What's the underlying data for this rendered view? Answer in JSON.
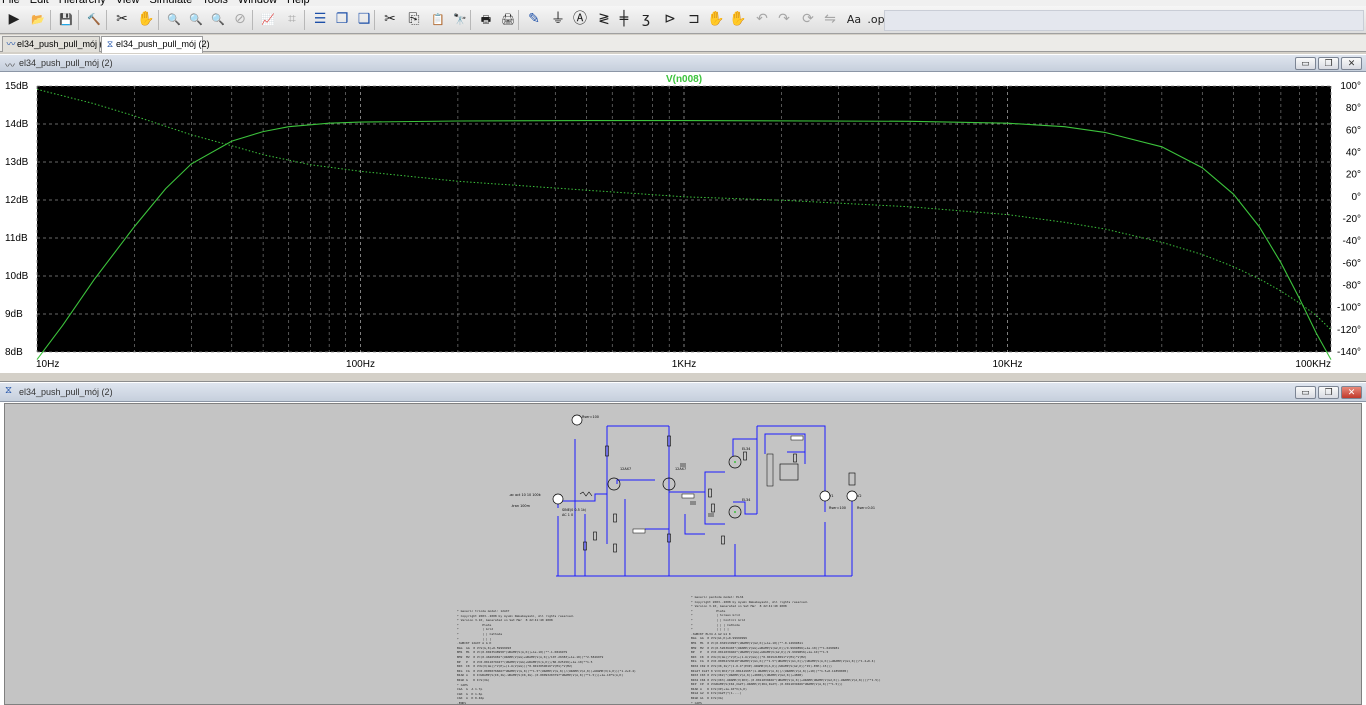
{
  "menubar": {
    "items": [
      "File",
      "Edit",
      "Hierarchy",
      "View",
      "Simulate",
      "Tools",
      "Window",
      "Help"
    ]
  },
  "toolbar": {
    "buttons": [
      {
        "icon": "run-icon",
        "glyph": "▶"
      },
      {
        "icon": "open-icon",
        "glyph": "📂"
      },
      {
        "icon": "save-icon",
        "glyph": "💾"
      },
      {
        "icon": "control-panel-icon",
        "glyph": "🔨"
      },
      {
        "icon": "halt-icon",
        "glyph": "✂"
      },
      {
        "icon": "pan-icon",
        "glyph": "✋"
      },
      {
        "icon": "zoom-in-icon",
        "glyph": "🔍"
      },
      {
        "icon": "zoom-back-icon",
        "glyph": "🔍"
      },
      {
        "icon": "zoom-out-icon",
        "glyph": "🔍"
      },
      {
        "icon": "zoom-fit-icon",
        "glyph": "⊘"
      },
      {
        "icon": "autorange-icon",
        "glyph": "📈"
      },
      {
        "icon": "grid-icon",
        "glyph": "⌗"
      },
      {
        "icon": "tile-horizontal-icon",
        "glyph": "☰"
      },
      {
        "icon": "cascade-icon",
        "glyph": "❐"
      },
      {
        "icon": "tile-vertical-icon",
        "glyph": "❑"
      },
      {
        "icon": "cut-icon",
        "glyph": "✂"
      },
      {
        "icon": "copy-icon",
        "glyph": "⎘"
      },
      {
        "icon": "paste-icon",
        "glyph": "📋"
      },
      {
        "icon": "find-icon",
        "glyph": "🔭"
      },
      {
        "icon": "print-icon",
        "glyph": "🖶"
      },
      {
        "icon": "print-setup-icon",
        "glyph": "🖨"
      },
      {
        "icon": "draw-wire-icon",
        "glyph": "✎"
      },
      {
        "icon": "ground-icon",
        "glyph": "⏚"
      },
      {
        "icon": "label-net-icon",
        "glyph": "Ⓐ"
      },
      {
        "icon": "resistor-icon",
        "glyph": "≷"
      },
      {
        "icon": "capacitor-icon",
        "glyph": "╪"
      },
      {
        "icon": "inductor-icon",
        "glyph": "ʒ"
      },
      {
        "icon": "diode-icon",
        "glyph": "⊳"
      },
      {
        "icon": "component-icon",
        "glyph": "⊐"
      },
      {
        "icon": "move-icon",
        "glyph": "✋"
      },
      {
        "icon": "drag-icon",
        "glyph": "✋"
      },
      {
        "icon": "undo-icon",
        "glyph": "↶"
      },
      {
        "icon": "redo-icon",
        "glyph": "↷"
      },
      {
        "icon": "rotate-icon",
        "glyph": "⟳"
      },
      {
        "icon": "mirror-icon",
        "glyph": "⇋"
      },
      {
        "icon": "text-icon",
        "glyph": "Aa"
      },
      {
        "icon": "spice-directive-icon",
        "glyph": ".op"
      }
    ]
  },
  "tabs": [
    {
      "label": "el34_push_pull_mój (2)",
      "icon": "waveform-icon"
    },
    {
      "label": "el34_push_pull_mój (2)",
      "icon": "schematic-icon"
    }
  ],
  "plot_window": {
    "title": "el34_push_pull_mój (2)"
  },
  "schematic_window": {
    "title": "el34_push_pull_mój (2)"
  },
  "window_buttons": {
    "minimize": "▭",
    "restore": "❐",
    "close": "✕"
  },
  "colors": {
    "plot_background": "#000000",
    "trace": "#3cc33c",
    "grid": "#8c8c8c",
    "wire": "#1c1cff",
    "schematic_background": "#c4c4c4"
  },
  "chart_data": {
    "type": "line",
    "title": "V(n008)",
    "x_scale": "log",
    "xlim": [
      10,
      100000
    ],
    "x_ticks": [
      "10Hz",
      "100Hz",
      "1KHz",
      "10KHz",
      "100KHz"
    ],
    "ylim": [
      8,
      15
    ],
    "y_ticks": [
      "8dB",
      "9dB",
      "10dB",
      "11dB",
      "12dB",
      "13dB",
      "14dB",
      "15dB"
    ],
    "y2lim": [
      -140,
      100
    ],
    "y2_ticks": [
      "-140°",
      "-120°",
      "-100°",
      "-80°",
      "-60°",
      "-40°",
      "-20°",
      "0°",
      "20°",
      "40°",
      "60°",
      "80°",
      "100°"
    ],
    "grid": true,
    "series": [
      {
        "name": "V(n008)",
        "style": "solid",
        "axis": "left",
        "x": [
          10,
          12,
          15,
          20,
          25,
          30,
          40,
          50,
          60,
          80,
          100,
          200,
          500,
          1000,
          5000,
          10000,
          15000,
          20000,
          30000,
          40000,
          50000,
          60000,
          70000,
          80000,
          90000,
          100000
        ],
        "y": [
          7.8,
          8.7,
          9.9,
          11.3,
          12.3,
          12.95,
          13.55,
          13.8,
          13.93,
          14.02,
          14.05,
          14.08,
          14.09,
          14.09,
          14.07,
          14.02,
          13.93,
          13.78,
          13.4,
          12.85,
          12.15,
          11.3,
          10.35,
          9.4,
          8.5,
          7.8
        ]
      },
      {
        "name": "phase",
        "style": "dotted",
        "axis": "right",
        "x": [
          10,
          15,
          20,
          30,
          40,
          50,
          70,
          100,
          200,
          500,
          1000,
          2000,
          5000,
          10000,
          15000,
          20000,
          30000,
          40000,
          50000,
          60000,
          70000,
          80000,
          90000,
          100000
        ],
        "y": [
          97,
          84,
          73,
          56,
          46,
          38,
          29,
          23,
          14,
          6,
          0,
          -3,
          -9,
          -16,
          -23,
          -29,
          -41,
          -52,
          -63,
          -74,
          -85,
          -96,
          -107,
          -120
        ]
      }
    ]
  },
  "schematic": {
    "labels": {
      "source_params": "SINE(0 0.5 1k)",
      "source_ac": "AC 1 0",
      "dir1": ".ac oct 10 10 100k",
      "dir2": ".tran 100m",
      "tube1": "12AX7",
      "tube2": "12AX7",
      "tube3": "EL34",
      "tube4": "EL34",
      "hv_label": "Rser=100",
      "supply_label": "Rser=0.01",
      "supply2": "V1",
      "supply3": "V2"
    },
    "netlist_left": [
      "* Generic triode model: 12AX7",
      "* Copyright 2003--2008 by Ayumi Nakabayashi, All rights reserved.",
      "* Version 3.10, Generated on Sat Mar  8 22:41:40 2008",
      "*             Plate",
      "*             | Grid",
      "*             | | Cathode",
      "*             | | |",
      ".SUBCKT 12AX7 A G K",
      "BGG  GG  0 V=V(G,K)+0.59999993",
      "BM1  M1  0 V=(0.0023548958*(URAMP(V(A,K))+1e-10))**-1.0846979",
      "BM2  M2  0 V=(0.46265981*(URAMP(V(GG)+URAMP(V(A,K))/107.26383)+1e-10))**2.5846979",
      "BP   P   0 V=0.0011079427*(URAMP(V(GG)+URAMP(V(A,K))/86.025156)+1e-10)**1.5",
      "BIK  IK  0 V=U(V(GG))*V(P)+(1-U(V(GG)))*0.0013059016*V(M1)*V(M2)",
      "BIG  IG  0 V=0.00050766667*URAMP(V(G,K))**1.5*(URAMP(V(G,K))/(URAMP(V(A,K))+URAMP(V(G,K)))*1.2+0.4)",
      "BIAK A   K I=URAMP(V(IK,IG)-URAMP(V(IK,IG)-(0.00093203797*URAMP(V(A,K))**1.5)))+1e-10*V(A,K)",
      "BIGK G   K I=V(IG)",
      "* CAPS",
      "CGA  G  A 1.7p",
      "CGK  G  K 1.6p",
      "CAK  A  K 0.46p",
      ".ENDS"
    ],
    "netlist_right": [
      "* Generic pentode model: EL34",
      "* Copyright 2003--2008 by Ayumi Nakabayashi, All rights reserved.",
      "* Version 3.10, Generated on Sat Mar  8 22:41:40 2008",
      "*             Plate",
      "*             | Screen Grid",
      "*             | | Control Grid",
      "*             | | | Cathode",
      "*             | | | |",
      ".SUBCKT EL34 A G2 G1 K",
      "BGG  GG  0 V=V(G1,K)+0.99999999",
      "BM1  M1  0 V=(0.034513998*(URAMP(V(G2,K))+1e-10))**-0.14999811",
      "BM2  M2  0 V=(0.52636403*(URAMP(V(GG)+URAMP(V(G2,K))/9.9999856)+1e-10))**1.6499981",
      "BP   P   0 V=0.0011039466*(URAMP(V(GG)+URAMP(V(G2,K))/9.9999856)+1e-10)**1.5",
      "BIK  IK  0 V=U(V(GG))*V(P)+(1-U(V(GG)))*0.0015218591*V(M1)*V(M2)",
      "BIG  IG  0 V=0.00054723618*URAMP(V(G1,K))**1.5*(URAMP(V(G1,K))/(URAMP(V(A,K))+URAMP(V(G1,K)))*1.2+0.4)",
      "BIK2 IK2 0 V=V(IK,IG)*(1-0.4*(EXP(-URAMP(V(A,K))/URAMP(V(G2,K))*15)-EXP(-15)))",
      "BIG2T IG2T 0 V=V(IK2)*(0.88141995*(1-URAMP(V(A,K))/(URAMP(V(A,K))+10))**1.5+0.11858005)",
      "BIK3 IK3 0 V=V(IK2)*(URAMP(V(A,K))+4800)/(URAMP(V(G2,K))+4800)",
      "BIK4 IK4 0 V=V(IK3)-URAMP(V(IK3)-(0.0011039466*(URAMP(V(A,K))+URAMP(URAMP(V(G2,K))-URAMP(V(A,K))))**1.5))",
      "BIP  IP  0 V=URAMP(V(IK4,IG2T)-URAMP(V(IK4,IG2T)-(0.0011039466*URAMP(V(A,K))**1.5)))",
      "BIAK A   K I=V(IP)+1e-10*V(A,K)",
      "BIG2 G2  K I=V(IG2T)*(1-...)",
      "BIGK G1  K I=V(IG)",
      "* CAPS",
      "CG1A G1 A 1.1p",
      "CG1K G1 K 15.6p",
      "CAK  A  K 8.4p",
      ".ENDS"
    ]
  }
}
